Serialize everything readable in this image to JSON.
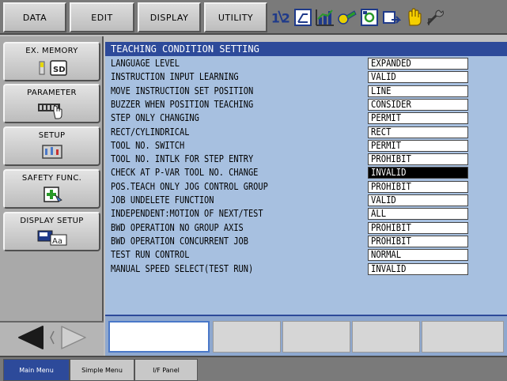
{
  "top_menu": {
    "data": "DATA",
    "edit": "EDIT",
    "display": "DISPLAY",
    "utility": "UTILITY"
  },
  "status_icons": [
    "coordinate-icon",
    "teach-mode-icon",
    "chart-icon",
    "tool-icon",
    "execution-icon",
    "cycle-icon",
    "hand-icon",
    "wrench-icon"
  ],
  "sidebar": {
    "items": [
      {
        "label": "EX. MEMORY",
        "icon": "sd-card-icon"
      },
      {
        "label": "PARAMETER",
        "icon": "parameter-hand-icon"
      },
      {
        "label": "SETUP",
        "icon": "setup-icon"
      },
      {
        "label": "SAFETY FUNC.",
        "icon": "safety-icon"
      },
      {
        "label": "DISPLAY SETUP",
        "icon": "display-setup-icon"
      }
    ],
    "nav_icons": [
      "left-arrow-icon",
      "right-arrow-icon"
    ]
  },
  "main": {
    "title": "TEACHING CONDITION SETTING",
    "rows": [
      {
        "label": "LANGUAGE LEVEL",
        "value": "EXPANDED"
      },
      {
        "label": "INSTRUCTION INPUT LEARNING",
        "value": "VALID"
      },
      {
        "label": "MOVE INSTRUCTION SET POSITION",
        "value": "LINE"
      },
      {
        "label": "BUZZER WHEN POSITION TEACHING",
        "value": "CONSIDER"
      },
      {
        "label": "STEP ONLY CHANGING",
        "value": "PERMIT"
      },
      {
        "label": "RECT/CYLINDRICAL",
        "value": "RECT"
      },
      {
        "label": "TOOL NO. SWITCH",
        "value": "PERMIT"
      },
      {
        "label": "TOOL NO. INTLK FOR STEP ENTRY",
        "value": "PROHIBIT"
      },
      {
        "label": "CHECK AT P-VAR TOOL NO. CHANGE",
        "value": "INVALID"
      },
      {
        "label": "POS.TEACH ONLY JOG CONTROL GROUP",
        "value": "PROHIBIT"
      },
      {
        "label": "JOB UNDELETE FUNCTION",
        "value": "VALID"
      },
      {
        "label": "INDEPENDENT:MOTION OF NEXT/TEST",
        "value": "ALL"
      },
      {
        "label": "BWD OPERATION NO GROUP AXIS",
        "value": "PROHIBIT"
      },
      {
        "label": "BWD OPERATION CONCURRENT JOB",
        "value": "PROHIBIT"
      },
      {
        "label": "TEST RUN CONTROL",
        "value": "NORMAL"
      },
      {
        "label": "MANUAL SPEED SELECT(TEST RUN)",
        "value": "INVALID"
      }
    ],
    "selected_row": 8
  },
  "bottom_tabs": {
    "main_menu": "Main Menu",
    "simple_menu": "Simple Menu",
    "if_panel": "I/F Panel"
  },
  "colors": {
    "title_bar": "#2d4a9a",
    "main_bg": "#a7c0e0",
    "selected_bg": "#000000"
  }
}
